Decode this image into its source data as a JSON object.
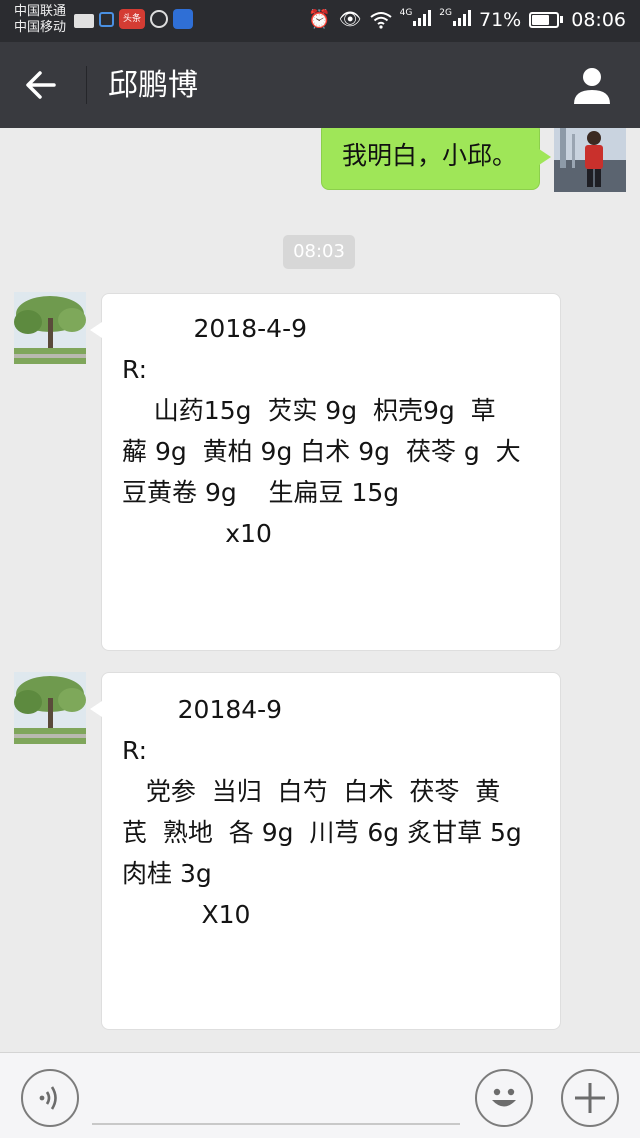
{
  "status_bar": {
    "carrier_1": "中国联通",
    "carrier_2": "中国移动",
    "toutiao_badge": "头条",
    "signal_1_label": "4G",
    "signal_2_label": "2G",
    "battery_percent": "71%",
    "battery_level": 0.71,
    "time": "08:06",
    "icons": [
      "briefcase-icon",
      "lock-icon",
      "toutiao-icon",
      "chat-bubble-icon",
      "paw-icon",
      "alarm-icon",
      "eye-icon",
      "wifi-icon",
      "signal-icon",
      "battery-icon"
    ]
  },
  "header": {
    "title": "邱鹏博",
    "back_icon": "back-arrow-icon",
    "profile_icon": "person-icon"
  },
  "messages": {
    "sent": {
      "text": "我明白，小邱。"
    },
    "timestamp": "08:03",
    "recv_1": {
      "lines": [
        "         2018-4-9",
        "",
        "R:",
        "    山药15g  芡实 9g  枳壳9g  草",
        "薢 9g  黄柏 9g 白术 9g  茯苓 g  大",
        "豆黄卷 9g    生扁豆 15g",
        "",
        "             x10"
      ]
    },
    "recv_2": {
      "lines": [
        "       20184-9",
        "",
        "R:",
        "   党参  当归  白芍  白术  茯苓  黄",
        "芪  熟地  各 9g  川芎 6g 炙甘草 5g",
        "肉桂 3g",
        "",
        "          X10"
      ]
    }
  },
  "input_bar": {
    "voice_icon": "voice-icon",
    "emoji_icon": "emoji-icon",
    "plus_icon": "plus-icon",
    "input_value": ""
  },
  "colors": {
    "title_bar": "#393a3f",
    "status_bar": "#2b2c30",
    "background": "#ebebeb",
    "sent_bubble": "#9fe658",
    "recv_bubble": "#ffffff"
  }
}
